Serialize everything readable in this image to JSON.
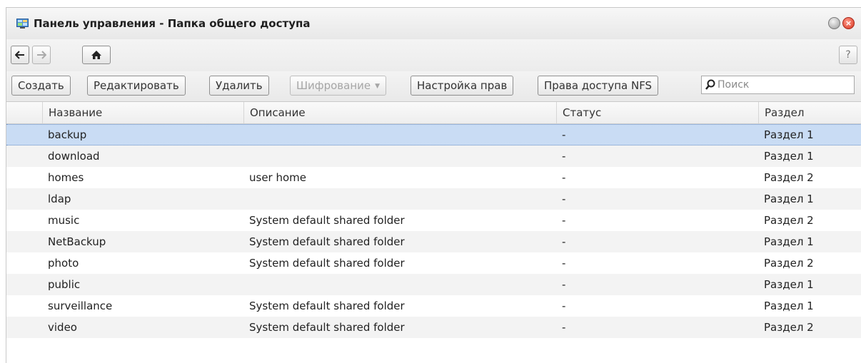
{
  "window": {
    "title": "Панель управления - Папка общего доступа",
    "help_label": "?"
  },
  "toolbar": {
    "create": "Создать",
    "edit": "Редактировать",
    "delete": "Удалить",
    "encryption": "Шифрование",
    "permissions": "Настройка прав",
    "nfs": "Права доступа NFS"
  },
  "search": {
    "placeholder": "Поиск",
    "value": ""
  },
  "table": {
    "columns": [
      "Название",
      "Описание",
      "Статус",
      "Раздел"
    ],
    "rows": [
      {
        "name": "backup",
        "description": "",
        "status": "-",
        "partition": "Раздел 1",
        "selected": true
      },
      {
        "name": "download",
        "description": "",
        "status": "-",
        "partition": "Раздел 1"
      },
      {
        "name": "homes",
        "description": "user home",
        "status": "-",
        "partition": "Раздел 2"
      },
      {
        "name": "ldap",
        "description": "",
        "status": "-",
        "partition": "Раздел 1"
      },
      {
        "name": "music",
        "description": "System default shared folder",
        "status": "-",
        "partition": "Раздел 2"
      },
      {
        "name": "NetBackup",
        "description": "System default shared folder",
        "status": "-",
        "partition": "Раздел 1"
      },
      {
        "name": "photo",
        "description": "System default shared folder",
        "status": "-",
        "partition": "Раздел 2"
      },
      {
        "name": "public",
        "description": "",
        "status": "-",
        "partition": "Раздел 1"
      },
      {
        "name": "surveillance",
        "description": "System default shared folder",
        "status": "-",
        "partition": "Раздел 1"
      },
      {
        "name": "video",
        "description": "System default shared folder",
        "status": "-",
        "partition": "Раздел 2"
      }
    ]
  },
  "icons": {
    "app": "control-panel-icon",
    "minimize": "minimize-icon",
    "close": "close-icon",
    "back": "arrow-left-icon",
    "forward": "arrow-right-icon",
    "home": "home-icon",
    "search": "search-icon"
  },
  "colors": {
    "selected_row": "#c9dcf4",
    "close_button": "#d8341e"
  }
}
